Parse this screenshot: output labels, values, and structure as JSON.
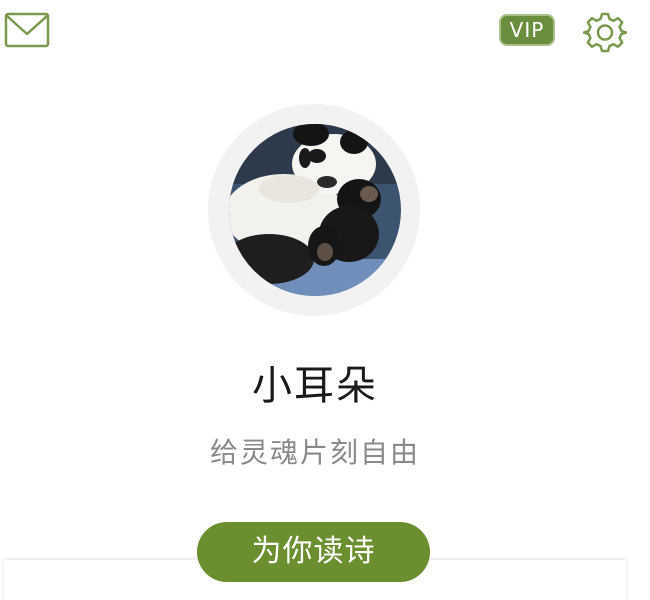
{
  "header": {
    "mail_icon": "envelope-icon",
    "vip_label": "VIP",
    "settings_icon": "gear-icon"
  },
  "profile": {
    "avatar": "panda-avatar-photo",
    "username": "小耳朵",
    "motto": "给灵魂片刻自由"
  },
  "actions": {
    "read_poem_label": "为你读诗"
  },
  "colors": {
    "accent": "#6b8e2f",
    "vip_bg": "#6b8e3e",
    "icon_green": "#7a9a4e",
    "motto_gray": "#8a8a8a"
  }
}
